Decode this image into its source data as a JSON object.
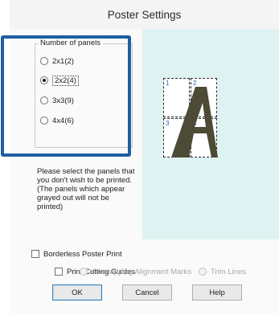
{
  "window": {
    "title": "Poster Settings"
  },
  "panels_group": {
    "legend": "Number of panels",
    "options": [
      {
        "label": "2x1(2)",
        "checked": false
      },
      {
        "label": "2x2(4)",
        "checked": true
      },
      {
        "label": "3x3(9)",
        "checked": false
      },
      {
        "label": "4x4(6)",
        "checked": false
      }
    ]
  },
  "hint": "Please select the panels that you don't wish to be printed. (The panels which appear grayed out will not be printed)",
  "preview": {
    "panel_numbers": [
      "1",
      "2",
      "3",
      "4"
    ],
    "glyph_color": "#4d4a36"
  },
  "borderless": {
    "label": "Borderless Poster Print",
    "checked": false
  },
  "cutting_guides": {
    "label": "Print Cutting Guides",
    "checked": false,
    "sub_options": [
      {
        "label": "Overlapping Alignment Marks",
        "enabled": false
      },
      {
        "label": "Trim Lines",
        "enabled": false
      }
    ]
  },
  "buttons": {
    "ok": "OK",
    "cancel": "Cancel",
    "help": "Help"
  },
  "colors": {
    "highlight": "#1f5fa3",
    "preview_bg": "#dff2f2"
  }
}
